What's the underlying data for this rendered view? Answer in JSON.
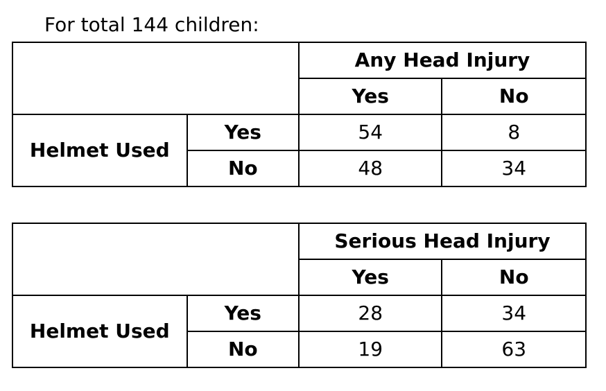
{
  "caption": "For total 144 children:",
  "tables": [
    {
      "outcome_header": "Any Head Injury",
      "outcome_levels": [
        "Yes",
        "No"
      ],
      "row_variable": "Helmet Used",
      "rows": [
        {
          "label": "Yes",
          "values": [
            "54",
            "8"
          ]
        },
        {
          "label": "No",
          "values": [
            "48",
            "34"
          ]
        }
      ]
    },
    {
      "outcome_header": "Serious Head Injury",
      "outcome_levels": [
        "Yes",
        "No"
      ],
      "row_variable": "Helmet Used",
      "rows": [
        {
          "label": "Yes",
          "values": [
            "28",
            "34"
          ]
        },
        {
          "label": "No",
          "values": [
            "19",
            "63"
          ]
        }
      ]
    }
  ]
}
